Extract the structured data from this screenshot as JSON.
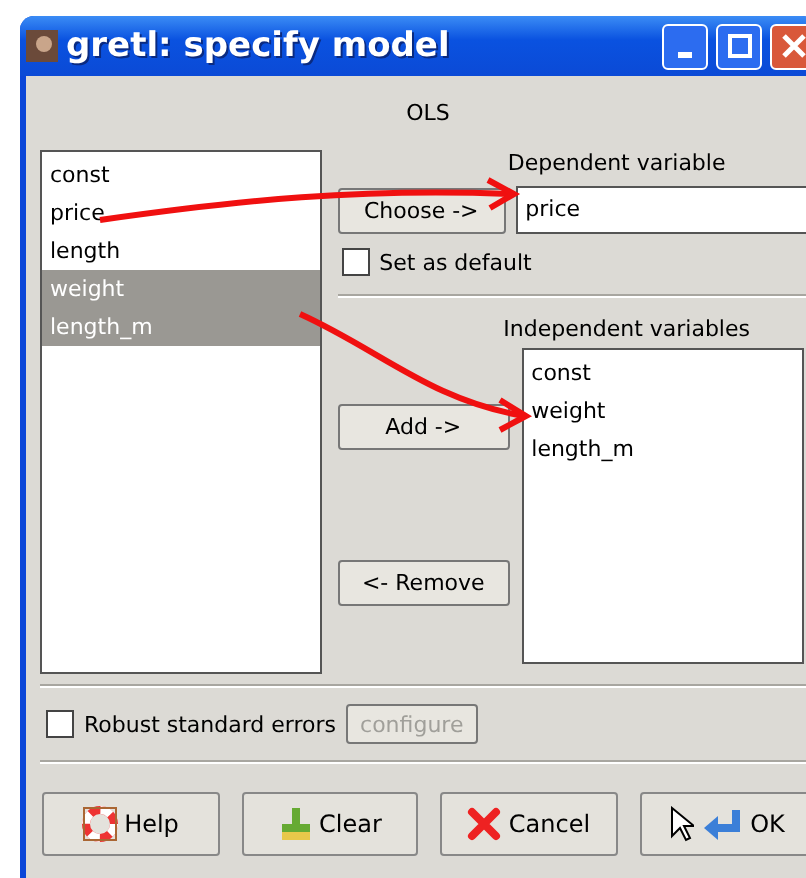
{
  "window": {
    "title": "gretl: specify model"
  },
  "estimator": "OLS",
  "variables": [
    {
      "name": "const",
      "selected": false
    },
    {
      "name": "price",
      "selected": false
    },
    {
      "name": "length",
      "selected": false
    },
    {
      "name": "weight",
      "selected": true
    },
    {
      "name": "length_m",
      "selected": true
    }
  ],
  "dependent": {
    "label": "Dependent variable",
    "button": "Choose ->",
    "value": "price",
    "set_default": {
      "label": "Set as default",
      "checked": false
    }
  },
  "independent": {
    "label": "Independent variables",
    "add_button": "Add ->",
    "remove_button": "<- Remove",
    "items": [
      "const",
      "weight",
      "length_m"
    ]
  },
  "robust": {
    "label": "Robust standard errors",
    "checked": false,
    "configure": {
      "label": "configure",
      "disabled": true
    }
  },
  "buttons": [
    {
      "kind": "help",
      "label": "Help"
    },
    {
      "kind": "clear",
      "label": "Clear"
    },
    {
      "kind": "cancel",
      "label": "Cancel"
    },
    {
      "kind": "ok",
      "label": "OK"
    }
  ]
}
